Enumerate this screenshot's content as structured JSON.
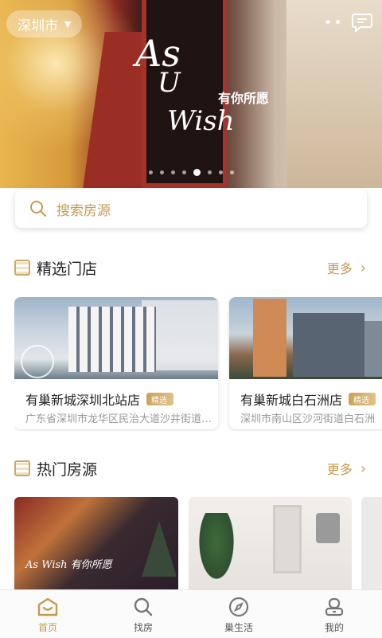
{
  "header": {
    "city": "深圳市",
    "city_caret": "▼"
  },
  "banner": {
    "slogan_en_1": "As",
    "slogan_en_2": "U",
    "slogan_en_3": "Wish",
    "slogan_cn": "有你所愿",
    "slide_count": 8,
    "active_slide": 5
  },
  "search": {
    "placeholder": "搜索房源"
  },
  "featured_stores": {
    "title": "精选门店",
    "more": "更多",
    "items": [
      {
        "name": "有巢新城深圳北站店",
        "badge": "精选",
        "address": "广东省深圳市龙华区民治大道沙井街道一号"
      },
      {
        "name": "有巢新城白石洲店",
        "badge": "精选",
        "address": "深圳市南山区沙河街道白石洲"
      }
    ]
  },
  "hot_listings": {
    "title": "热门房源",
    "more": "更多",
    "logo_text": "As Wish 有你所愿"
  },
  "tabbar": {
    "items": [
      {
        "label": "首页",
        "icon": "home-icon",
        "active": true
      },
      {
        "label": "找房",
        "icon": "search-icon",
        "active": false
      },
      {
        "label": "巢生活",
        "icon": "compass-icon",
        "active": false
      },
      {
        "label": "我的",
        "icon": "profile-icon",
        "active": false
      }
    ]
  },
  "colors": {
    "accent": "#c59b54"
  }
}
